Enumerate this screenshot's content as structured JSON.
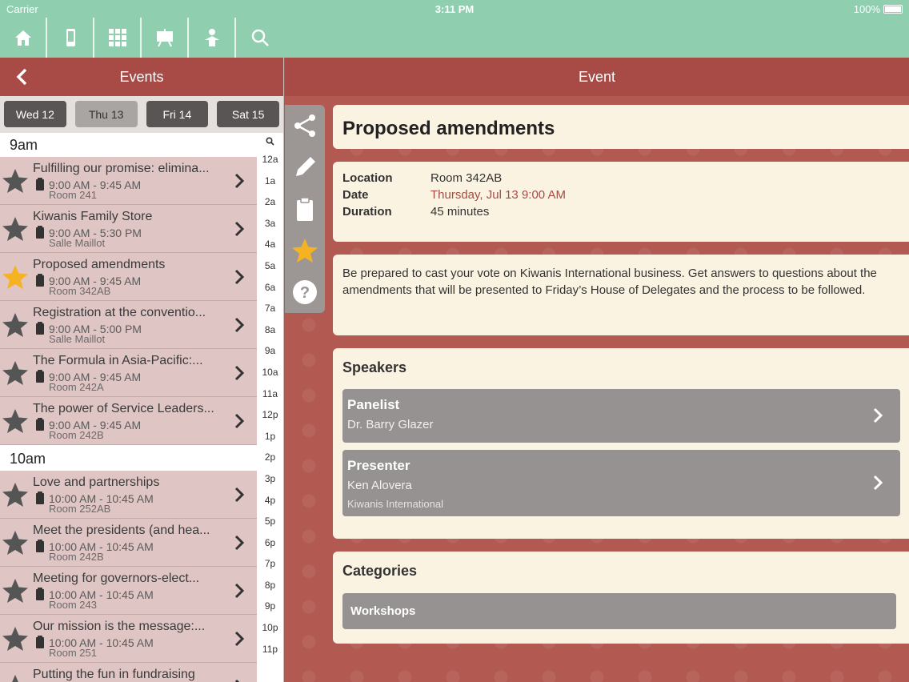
{
  "status": {
    "carrier": "Carrier",
    "time": "3:11 PM",
    "battery": "100%"
  },
  "toolbar": {
    "icons": [
      "home-icon",
      "phone-icon",
      "grid-icon",
      "easel-icon",
      "person-icon",
      "search-icon"
    ]
  },
  "left": {
    "title": "Events",
    "days": [
      "Wed 12",
      "Thu 13",
      "Fri 14",
      "Sat 15"
    ],
    "active_day": "Thu 13",
    "groups": [
      {
        "hour": "9am",
        "events": [
          {
            "title": "Fulfilling our promise: elimina...",
            "time": "9:00 AM - 9:45 AM",
            "room": "Room 241",
            "starred": false
          },
          {
            "title": "Kiwanis Family Store",
            "time": "9:00 AM - 5:30 PM",
            "room": "Salle Maillot",
            "starred": false
          },
          {
            "title": "Proposed amendments",
            "time": "9:00 AM - 9:45 AM",
            "room": "Room 342AB",
            "starred": true
          },
          {
            "title": "Registration at the conventio...",
            "time": "9:00 AM - 5:00 PM",
            "room": "Salle Maillot",
            "starred": false
          },
          {
            "title": "The Formula in Asia-Pacific:...",
            "time": "9:00 AM - 9:45 AM",
            "room": "Room 242A",
            "starred": false
          },
          {
            "title": "The power of Service Leaders...",
            "time": "9:00 AM - 9:45 AM",
            "room": "Room 242B",
            "starred": false
          }
        ]
      },
      {
        "hour": "10am",
        "events": [
          {
            "title": "Love and partnerships",
            "time": "10:00 AM - 10:45 AM",
            "room": "Room 252AB",
            "starred": false
          },
          {
            "title": "Meet the presidents (and hea...",
            "time": "10:00 AM - 10:45 AM",
            "room": "Room 242B",
            "starred": false
          },
          {
            "title": "Meeting for governors-elect...",
            "time": "10:00 AM - 10:45 AM",
            "room": "Room 243",
            "starred": false
          },
          {
            "title": "Our mission is the message:...",
            "time": "10:00 AM - 10:45 AM",
            "room": "Room 251",
            "starred": false
          },
          {
            "title": "Putting the fun in fundraising",
            "time": "",
            "room": "",
            "starred": false
          }
        ]
      }
    ],
    "index": [
      "12a",
      "1a",
      "2a",
      "3a",
      "4a",
      "5a",
      "6a",
      "7a",
      "8a",
      "9a",
      "10a",
      "11a",
      "12p",
      "1p",
      "2p",
      "3p",
      "4p",
      "5p",
      "6p",
      "7p",
      "8p",
      "9p",
      "10p",
      "11p"
    ]
  },
  "right": {
    "header": "Event",
    "title": "Proposed amendments",
    "info": [
      {
        "label": "Location",
        "value": "Room 342AB"
      },
      {
        "label": "Date",
        "value": "Thursday, Jul 13 9:00 AM"
      },
      {
        "label": "Duration",
        "value": "45 minutes"
      }
    ],
    "description": "Be prepared to cast your vote on Kiwanis International business. Get answers to questions about the amendments that will be presented to Friday’s House of Delegates and the process to be followed.",
    "speakers_title": "Speakers",
    "speakers": [
      {
        "role": "Panelist",
        "name": "Dr. Barry Glazer",
        "org": ""
      },
      {
        "role": "Presenter",
        "name": "Ken Alovera",
        "org": "Kiwanis International"
      }
    ],
    "categories_title": "Categories",
    "categories": [
      "Workshops"
    ]
  },
  "colors": {
    "toolbar": "#8fcfb0",
    "header": "#a84a45",
    "accent_star": "#f5b324",
    "card": "#fbf3e1"
  }
}
